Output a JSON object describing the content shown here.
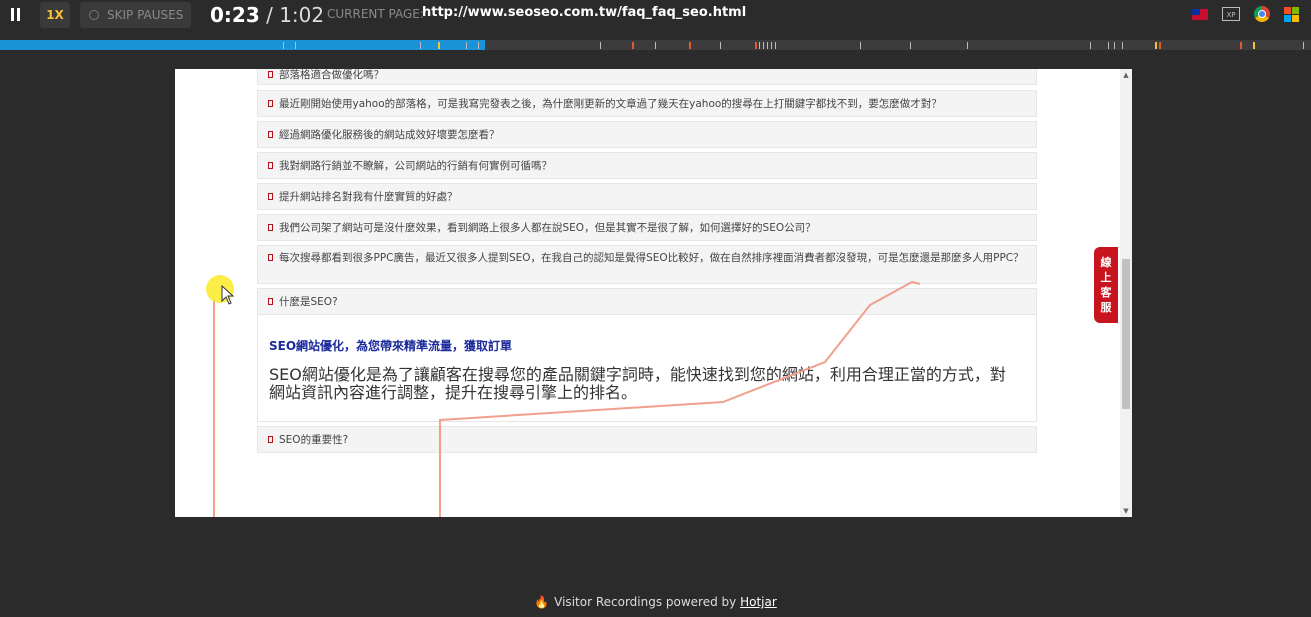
{
  "player": {
    "speed_label": "1X",
    "skip_label": "SKIP PAUSES",
    "time_current": "0:23",
    "time_separator": " / ",
    "time_total": "1:02",
    "current_page_label": "CURRENT PAGE:",
    "current_page_url": "http://www.seoseo.com.tw/faq_faq_seo.html",
    "progress_fraction": 0.37,
    "os_icon_text": "XP"
  },
  "page": {
    "faq_items": [
      {
        "text": "部落格適合做優化嗎？"
      },
      {
        "text": "最近剛開始使用yahoo的部落格，可是我寫完發表之後，為什麼剛更新的文章過了幾天在yahoo的搜尋在上打關鍵字都找不到，要怎麼做才對？"
      },
      {
        "text": "經過網路優化服務後的網站成效好壞要怎麼看？"
      },
      {
        "text": "我對網路行銷並不瞭解，公司網站的行銷有何實例可循嗎？"
      },
      {
        "text": "提升網站排名對我有什麼實質的好處？"
      },
      {
        "text": "我們公司架了網站可是沒什麼效果，看到網路上很多人都在說SEO，但是其實不是很了解，如何選擇好的SEO公司？"
      },
      {
        "text": "每次搜尋都看到很多PPC廣告，最近又很多人提到SEO，在我自己的認知是覺得SEO比較好，做在自然排序裡面消費者都沒發現，可是怎麼還是那麼多人用PPC？"
      },
      {
        "text": "什麼是SEO?"
      }
    ],
    "answer_title": "SEO網站優化，為您帶來精準流量，獲取訂單",
    "answer_body": "SEO網站優化是為了讓顧客在搜尋您的產品關鍵字詞時，能快速找到您的網站，利用合理正當的方式，對網站資訊內容進行調整，提升在搜尋引擎上的排名。",
    "last_item": "SEO的重要性?",
    "chat_tab_chars": [
      "線",
      "上",
      "客",
      "服"
    ]
  },
  "footer": {
    "prefix": "Visitor Recordings powered by ",
    "brand": "Hotjar"
  },
  "colors": {
    "accent_blue": "#1a93d9",
    "accent_yellow": "#f6c233",
    "chat_red": "#c8141e",
    "mouse_trail": "#f0a08c"
  },
  "icons": [
    "pause-icon",
    "toggle-icon",
    "flag-icon",
    "os-icon",
    "chrome-icon",
    "windows-icon",
    "flame-icon",
    "cursor-icon"
  ]
}
